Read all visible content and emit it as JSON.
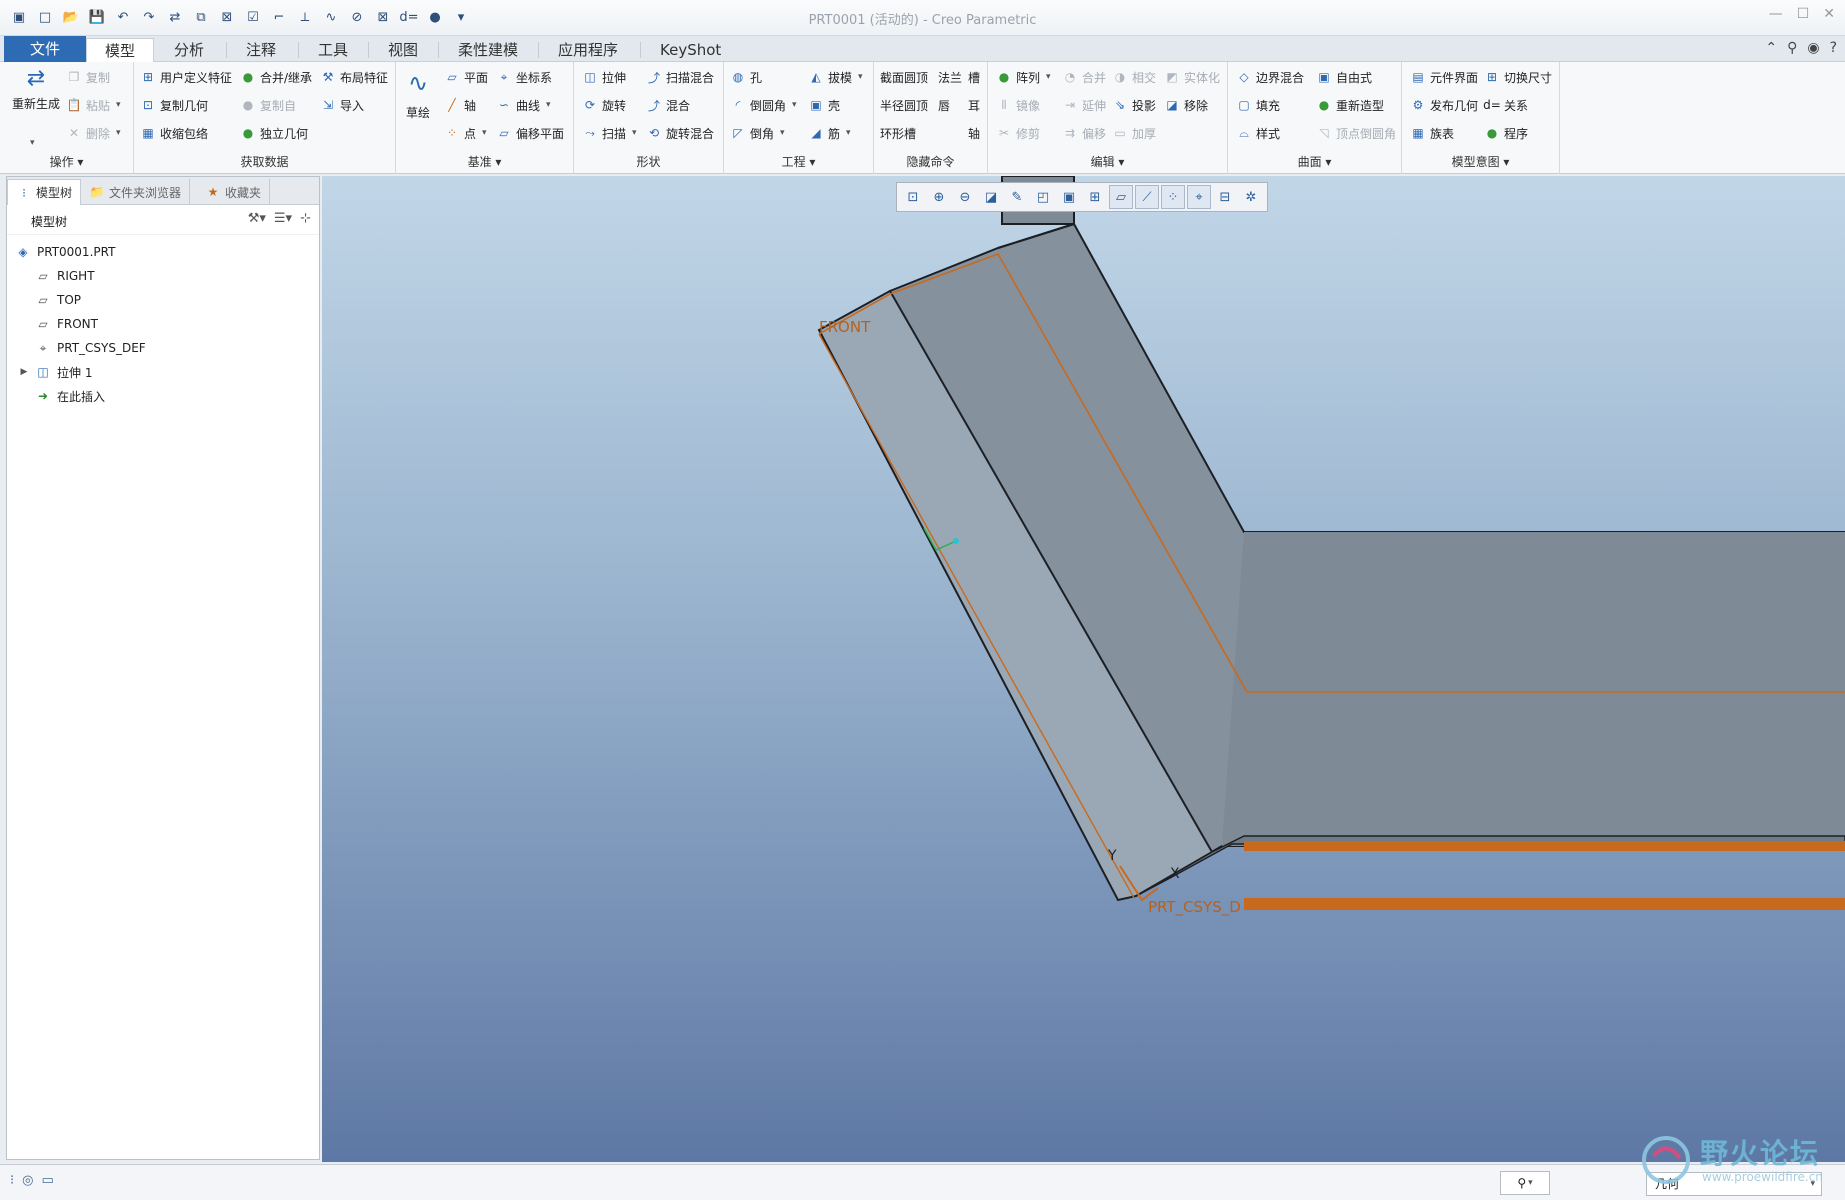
{
  "window": {
    "title": "PRT0001 (活动的) - Creo Parametric"
  },
  "tabs": [
    {
      "label": "文件"
    },
    {
      "label": "模型"
    },
    {
      "label": "分析"
    },
    {
      "label": "注释"
    },
    {
      "label": "工具"
    },
    {
      "label": "视图"
    },
    {
      "label": "柔性建模"
    },
    {
      "label": "应用程序"
    },
    {
      "label": "KeyShot"
    }
  ],
  "ribbon": {
    "operations": {
      "label": "操作",
      "regenerate": "重新生成",
      "copy": "复制",
      "paste": "粘贴",
      "delete": "删除"
    },
    "get_data": {
      "label": "获取数据",
      "udf": "用户定义特征",
      "copy_geom": "复制几何",
      "shrinkwrap": "收缩包络",
      "merge_inherit": "合并/继承",
      "copy_from": "复制自",
      "indep_geom": "独立几何",
      "layout_feat": "布局特征",
      "import": "导入"
    },
    "datum": {
      "label": "基准",
      "sketch": "草绘",
      "plane": "平面",
      "axis": "轴",
      "point": "点",
      "csys": "坐标系",
      "curve": "曲线",
      "offset_plane": "偏移平面"
    },
    "shapes": {
      "label": "形状",
      "extrude": "拉伸",
      "revolve": "旋转",
      "sweep": "扫描",
      "swept_blend": "扫描混合",
      "blend": "混合",
      "rot_blend": "旋转混合"
    },
    "engineering": {
      "label": "工程",
      "hole": "孔",
      "round": "倒圆角",
      "chamfer": "倒角",
      "draft": "拔模",
      "shell": "壳",
      "rib": "筋"
    },
    "hidden": {
      "label": "隐藏命令",
      "c1": "截面圆顶",
      "c2": "法兰",
      "c3": "槽",
      "c4": "半径圆顶",
      "c5": "唇",
      "c6": "耳",
      "c7": "环形槽",
      "c8": "轴"
    },
    "editing": {
      "label": "编辑",
      "pattern": "阵列",
      "mirror": "镜像",
      "trim": "修剪",
      "merge": "合并",
      "extend": "延伸",
      "offset": "偏移",
      "intersect": "相交",
      "project": "投影",
      "thicken": "加厚",
      "solidify": "实体化",
      "remove": "移除"
    },
    "surfaces": {
      "label": "曲面",
      "boundary_blend": "边界混合",
      "fill": "填充",
      "style": "样式",
      "freestyle": "自由式",
      "restyle": "重新造型",
      "vertex_round": "顶点倒圆角"
    },
    "model_intent": {
      "label": "模型意图",
      "component_interface": "元件界面",
      "publish_geom": "发布几何",
      "family_table": "族表",
      "switch_dims": "切换尺寸",
      "relations": "关系",
      "program": "程序"
    }
  },
  "left_panel": {
    "tabs": [
      {
        "label": "模型树"
      },
      {
        "label": "文件夹浏览器"
      },
      {
        "label": "收藏夹"
      }
    ],
    "tree_title": "模型树",
    "tree": [
      {
        "label": "PRT0001.PRT"
      },
      {
        "label": "RIGHT"
      },
      {
        "label": "TOP"
      },
      {
        "label": "FRONT"
      },
      {
        "label": "PRT_CSYS_DEF"
      },
      {
        "label": "拉伸 1"
      },
      {
        "label": "在此插入"
      }
    ]
  },
  "viewport": {
    "labels": {
      "front": "FRONT",
      "csys": "PRT_CSYS_D",
      "y": "Y",
      "x": "X"
    },
    "colors": {
      "face_light": "#9aa8b6",
      "face_mid": "#85919d",
      "face_dark": "#7e8a96",
      "edge": "#1c1f24",
      "datum": "#c86a1e"
    }
  },
  "status": {
    "filter": "几何"
  },
  "watermark": {
    "name": "野火论坛",
    "url": "www.proewildfire.cn"
  }
}
